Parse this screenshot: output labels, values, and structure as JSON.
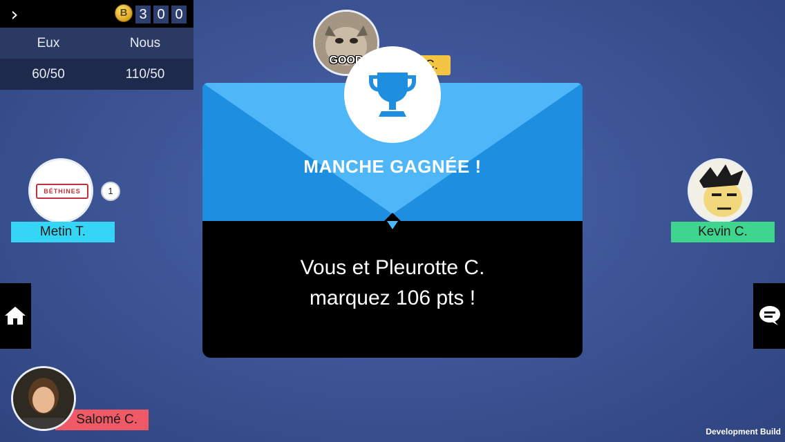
{
  "currency": {
    "digits": [
      "3",
      "0",
      "0"
    ],
    "coin_symbol": "B"
  },
  "scoreboard": {
    "col_left_label": "Eux",
    "col_right_label": "Nous",
    "col_left_value": "60/50",
    "col_right_value": "110/50"
  },
  "players": {
    "top": {
      "name_partial": "C.",
      "avatar_caption": "GOOD",
      "tag_color": "#f4c542"
    },
    "left": {
      "name": "Metin T.",
      "avatar_text": "BÉTHINES",
      "badge": "1",
      "tag_color": "#35d6f5"
    },
    "right": {
      "name": "Kevin C.",
      "tag_color": "#3fd58f"
    },
    "bottom": {
      "name": "Salomé C.",
      "tag_color": "#ef5a66"
    }
  },
  "modal": {
    "title": "MANCHE GAGNÉE !",
    "message_line1": "Vous et Pleurotte C.",
    "message_line2": "marquez 106 pts !",
    "icon": "trophy-icon"
  },
  "side_buttons": {
    "left_icon": "home-icon",
    "right_icon": "chat-icon"
  },
  "footer": {
    "build_label": "Development Build"
  }
}
